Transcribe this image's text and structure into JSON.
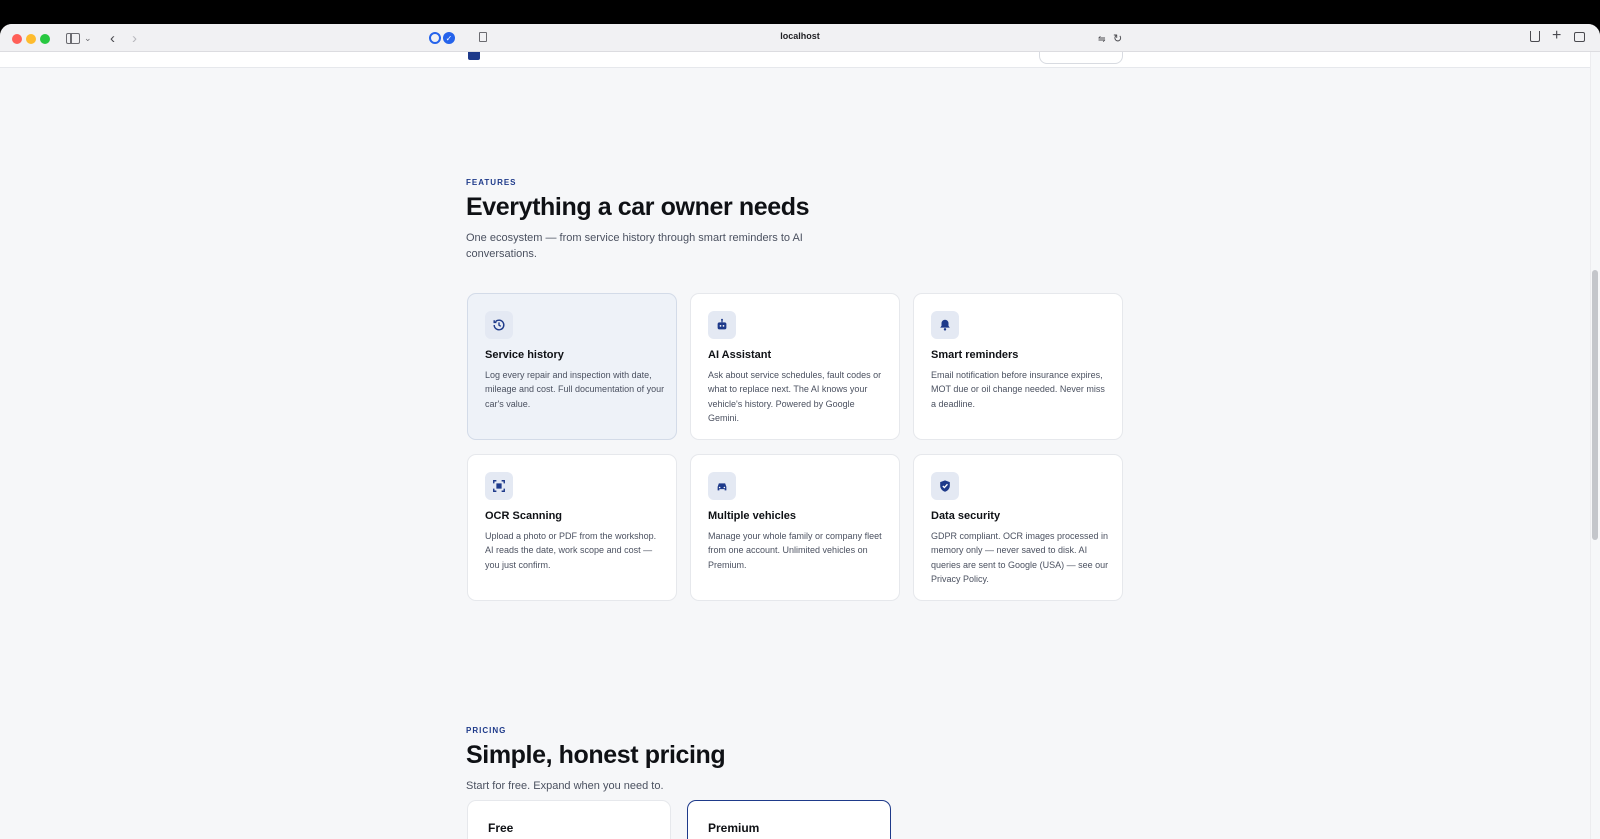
{
  "browser": {
    "url": "localhost"
  },
  "features": {
    "eyebrow": "FEATURES",
    "title": "Everything a car owner needs",
    "subtitle": "One ecosystem — from service history through smart reminders to AI conversations.",
    "cards": [
      {
        "icon": "history-icon",
        "title": "Service history",
        "desc": "Log every repair and inspection with date, mileage and cost. Full documentation of your car's value."
      },
      {
        "icon": "robot-icon",
        "title": "AI Assistant",
        "desc": "Ask about service schedules, fault codes or what to replace next. The AI knows your vehicle's history. Powered by Google Gemini."
      },
      {
        "icon": "bell-icon",
        "title": "Smart reminders",
        "desc": "Email notification before insurance expires, MOT due or oil change needed. Never miss a deadline."
      },
      {
        "icon": "scan-icon",
        "title": "OCR Scanning",
        "desc": "Upload a photo or PDF from the workshop. AI reads the date, work scope and cost — you just confirm."
      },
      {
        "icon": "car-icon",
        "title": "Multiple vehicles",
        "desc": "Manage your whole family or company fleet from one account. Unlimited vehicles on Premium."
      },
      {
        "icon": "shield-icon",
        "title": "Data security",
        "desc": "GDPR compliant. OCR images processed in memory only — never saved to disk. AI queries are sent to Google (USA) — see our Privacy Policy."
      }
    ]
  },
  "pricing": {
    "eyebrow": "PRICING",
    "title": "Simple, honest pricing",
    "subtitle": "Start for free. Expand when you need to.",
    "plans": [
      {
        "name": "Free"
      },
      {
        "name": "Premium"
      }
    ]
  },
  "colors": {
    "accent": "#1e3a8a",
    "page_bg": "#f6f7f9",
    "card_highlight": "#eef2f8"
  }
}
